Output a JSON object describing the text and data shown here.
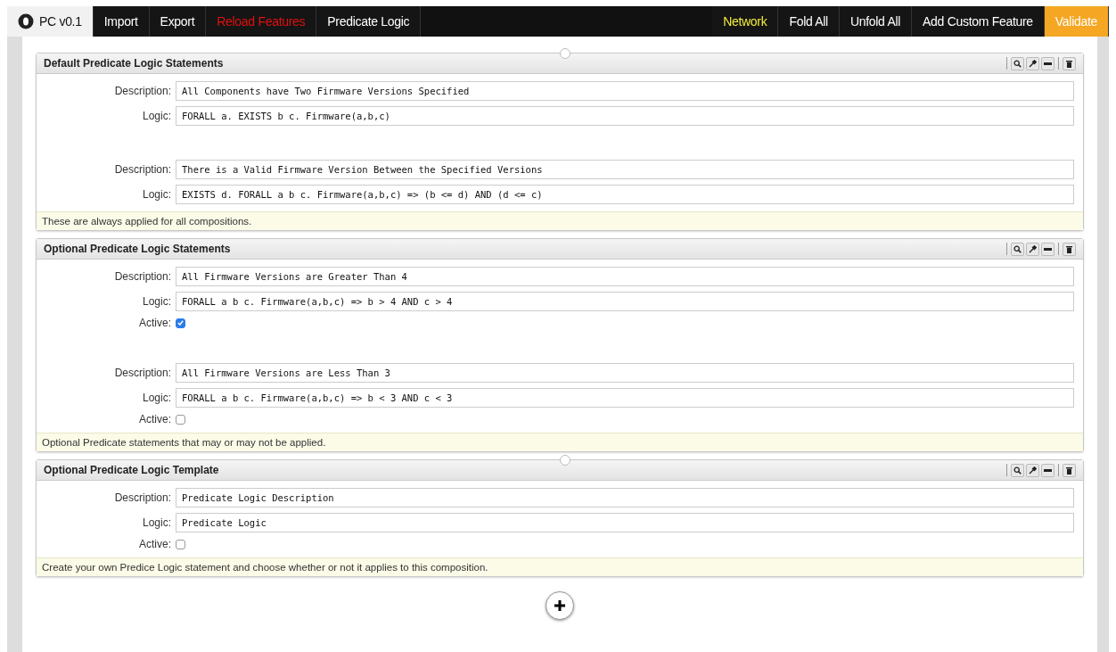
{
  "menu": [
    {
      "label": "PC v0.1",
      "kind": "brand"
    },
    {
      "label": "Import",
      "kind": "plain"
    },
    {
      "label": "Export",
      "kind": "plain"
    },
    {
      "label": "Reload Features",
      "kind": "danger"
    },
    {
      "label": "Predicate Logic",
      "kind": "plain"
    },
    {
      "label": "Network",
      "kind": "highlight"
    },
    {
      "label": "Fold All",
      "kind": "plain"
    },
    {
      "label": "Unfold All",
      "kind": "plain"
    },
    {
      "label": "Add Custom Feature",
      "kind": "plain"
    },
    {
      "label": "Validate",
      "kind": "primary"
    }
  ],
  "panels": [
    {
      "title": "Default Predicate Logic Statements",
      "statements": [
        {
          "description_label": "Description:",
          "description": "All Components have Two Firmware Versions Specified",
          "logic_label": "Logic:",
          "logic": "FORALL a. EXISTS b c. Firmware(a,b,c)"
        },
        {
          "description_label": "Description:",
          "description": "There is a Valid Firmware Version Between the Specified Versions",
          "logic_label": "Logic:",
          "logic": "EXISTS d. FORALL a b c. Firmware(a,b,c) => (b <= d) AND (d <= c)"
        }
      ],
      "note": "These are always applied for all compositions."
    },
    {
      "title": "Optional Predicate Logic Statements",
      "statements": [
        {
          "description_label": "Description:",
          "description": "All Firmware Versions are Greater Than 4",
          "logic_label": "Logic:",
          "logic": "FORALL a b c. Firmware(a,b,c) => b > 4 AND c > 4",
          "active_label": "Active:",
          "active": true
        },
        {
          "description_label": "Description:",
          "description": "All Firmware Versions are Less Than 3",
          "logic_label": "Logic:",
          "logic": "FORALL a b c. Firmware(a,b,c) => b < 3 AND c < 3",
          "active_label": "Active:",
          "active": false
        }
      ],
      "note": "Optional Predicate statements that may or may not be applied."
    },
    {
      "title": "Optional Predicate Logic Template",
      "statements": [
        {
          "description_label": "Description:",
          "description": "Predicate Logic Description",
          "logic_label": "Logic:",
          "logic": "Predicate Logic",
          "active_label": "Active:",
          "active": false
        }
      ],
      "note": "Create your own Predice Logic statement and choose whether or not it applies to this composition."
    }
  ]
}
